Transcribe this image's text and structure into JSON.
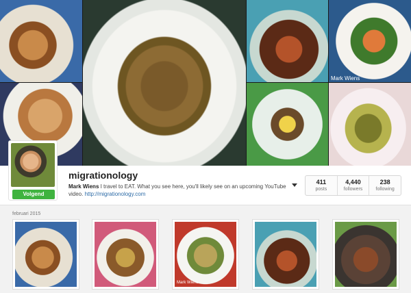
{
  "header": {
    "photos": [
      {
        "icon": "food-photo"
      },
      {
        "icon": "food-photo"
      },
      {
        "icon": "food-photo"
      },
      {
        "icon": "food-photo"
      },
      {
        "icon": "food-photo"
      },
      {
        "icon": "food-photo"
      },
      {
        "icon": "food-photo"
      }
    ],
    "watermark": "Mark Wiens"
  },
  "profile": {
    "username": "migrationology",
    "follow_label": "Volgend",
    "bio_name": "Mark Wiens",
    "bio_text": " I travel to EAT. What you see here, you'll likely see on an upcoming YouTube video. ",
    "bio_link": "http://migrationology.com",
    "stats": [
      {
        "value": "411",
        "label": "posts"
      },
      {
        "value": "4,440",
        "label": "followers"
      },
      {
        "value": "238",
        "label": "following"
      }
    ],
    "accent_color": "#3fb33f"
  },
  "feed": {
    "section_label": "februari 2015",
    "thumb_watermark": "Mark Wiens"
  }
}
